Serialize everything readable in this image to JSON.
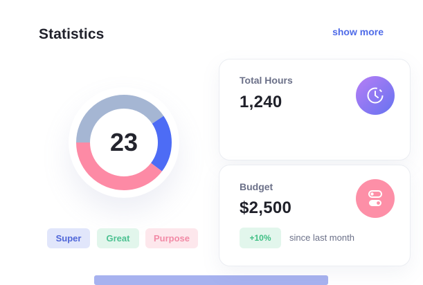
{
  "header": {
    "title": "Statistics",
    "show_more_label": "show more"
  },
  "donut": {
    "center_value": "23",
    "segments": [
      {
        "name": "top",
        "fraction": 0.406,
        "color": "#a5b6d3"
      },
      {
        "name": "right",
        "fraction": 0.197,
        "color": "#4d6cf5"
      },
      {
        "name": "bottom",
        "fraction": 0.397,
        "color": "#fd8aa5"
      }
    ],
    "legend": [
      {
        "label": "Super"
      },
      {
        "label": "Great"
      },
      {
        "label": "Purpose"
      }
    ]
  },
  "cards": {
    "hours": {
      "label": "Total Hours",
      "value": "1,240",
      "icon": "clock-icon"
    },
    "budget": {
      "label": "Budget",
      "value": "$2,500",
      "icon": "toggle-icon",
      "change": "+10%",
      "change_caption": "since last month"
    }
  },
  "colors": {
    "accent": "#4f6be8",
    "donut_top": "#a5b6d3",
    "donut_right": "#4d6cf5",
    "donut_bottom": "#fd8aa5",
    "clock_gradient_start": "#b67ef5",
    "clock_gradient_end": "#6673f0",
    "toggle_icon_bg": "#fd8fa7",
    "positive_change": "#3fbf84"
  }
}
